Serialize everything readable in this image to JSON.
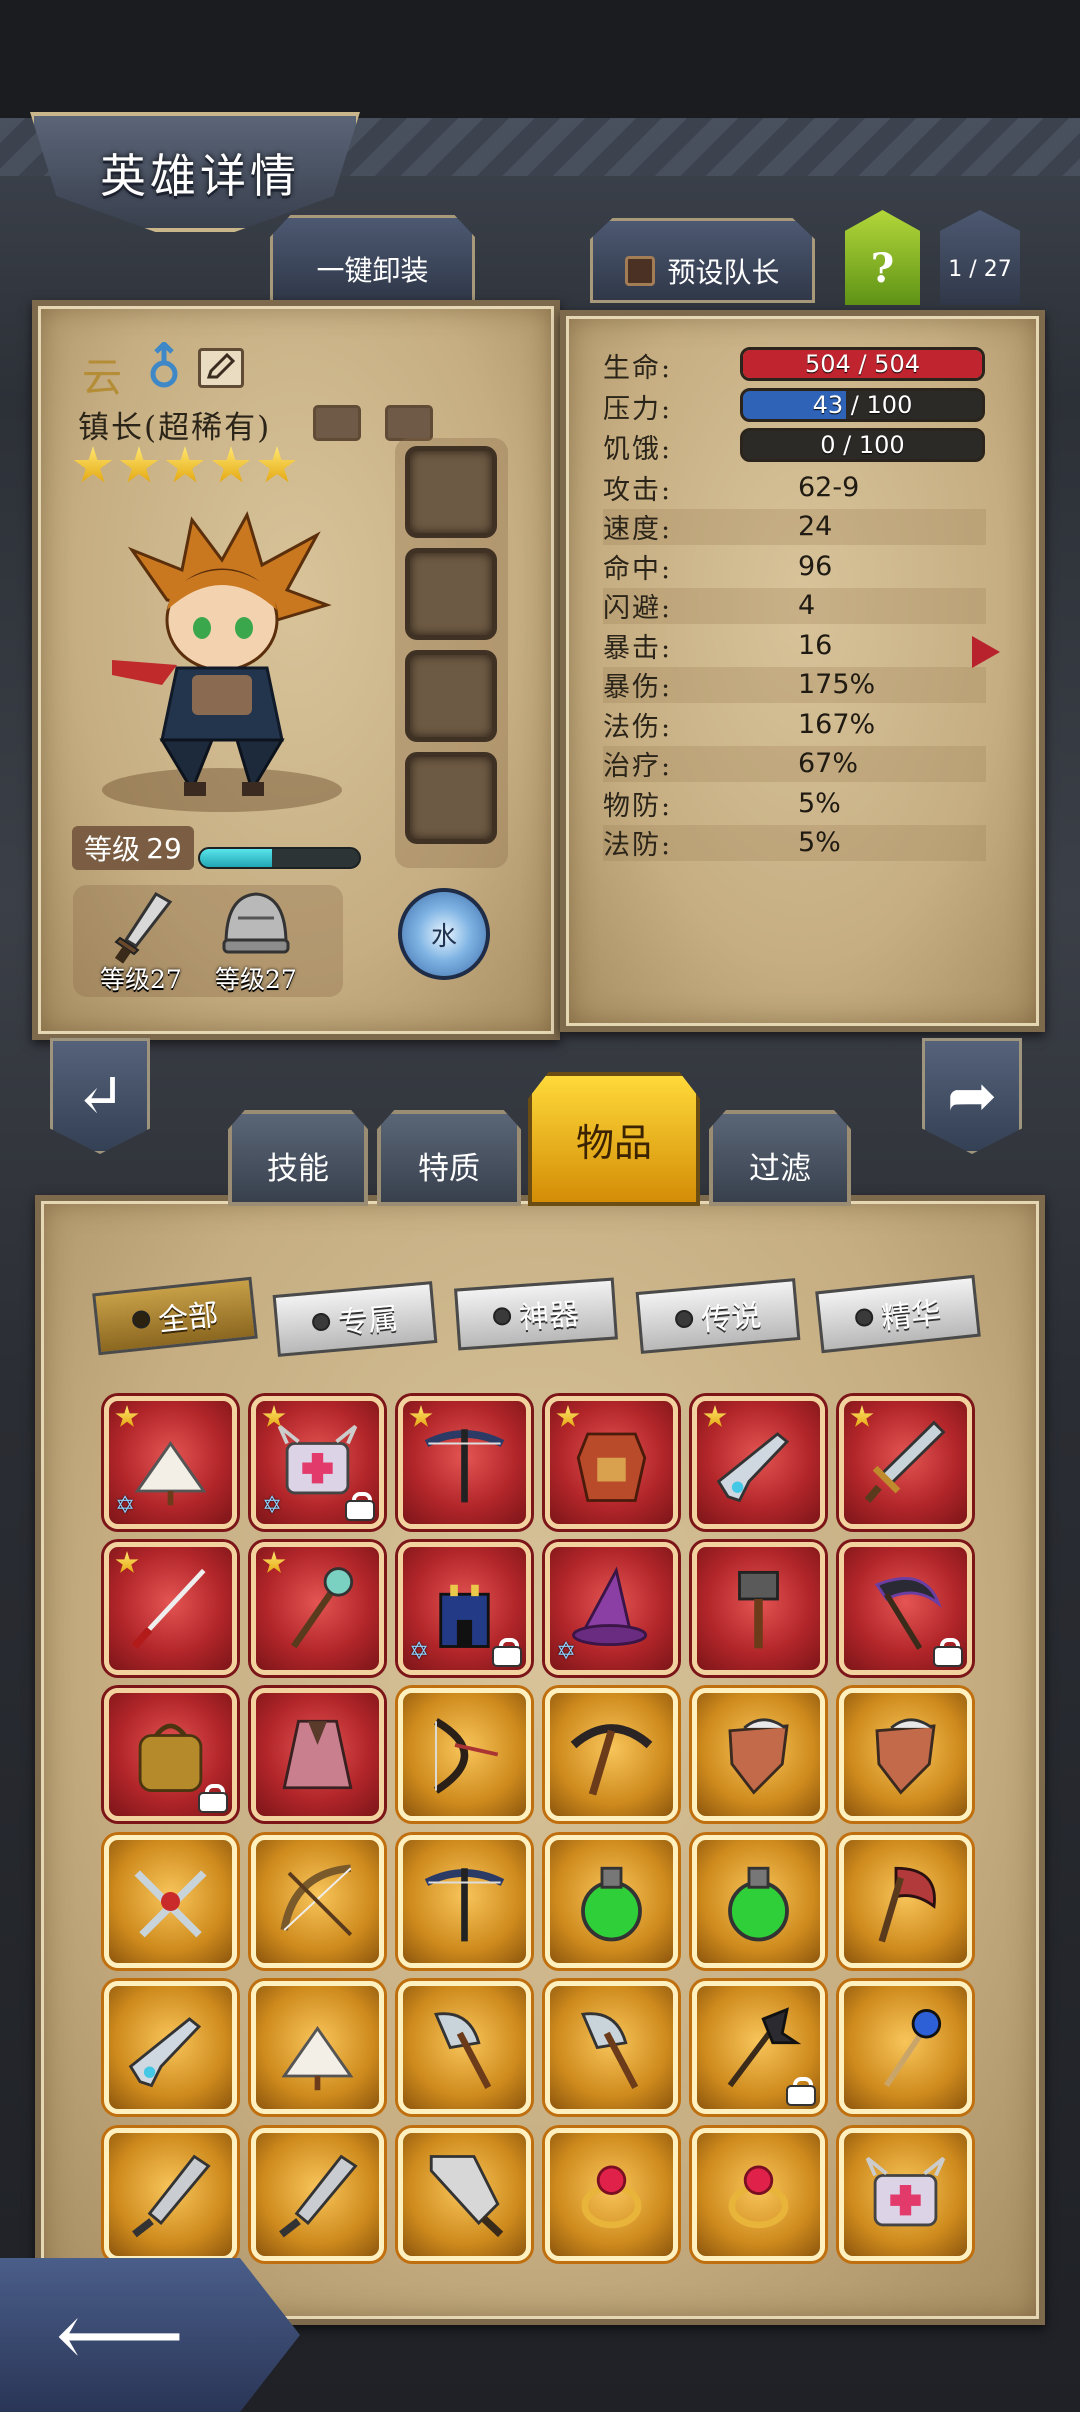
{
  "header": {
    "title": "英雄详情"
  },
  "top_buttons": {
    "unequip_all": "一键卸装",
    "preset_leader": "预设队长",
    "help": "?",
    "page_counter": "1 / 27"
  },
  "hero": {
    "element_char": "云",
    "gender_icon": "male-symbol-icon",
    "name": "镇长(超稀有)",
    "stars": 5,
    "level_label": "等级",
    "level": "29",
    "xp_fraction": 0.45,
    "gear": [
      {
        "icon": "sword-icon",
        "label": "等级27"
      },
      {
        "icon": "helmet-icon",
        "label": "等级27"
      }
    ],
    "element_badge": "水"
  },
  "stats": {
    "bars": [
      {
        "label": "生命:",
        "value": "504 / 504",
        "fraction": 1.0,
        "color": "#c0242f"
      },
      {
        "label": "压力:",
        "value": "43 / 100",
        "fraction": 0.43,
        "color": "#2e63b8"
      },
      {
        "label": "饥饿:",
        "value": "0 / 100",
        "fraction": 0.0,
        "color": "#555555"
      }
    ],
    "rows": [
      {
        "label": "攻击:",
        "value": "62-9"
      },
      {
        "label": "速度:",
        "value": "24"
      },
      {
        "label": "命中:",
        "value": "96"
      },
      {
        "label": "闪避:",
        "value": "4"
      },
      {
        "label": "暴击:",
        "value": "16"
      },
      {
        "label": "暴伤:",
        "value": "175%"
      },
      {
        "label": "法伤:",
        "value": "167%"
      },
      {
        "label": "治疗:",
        "value": "67%"
      },
      {
        "label": "物防:",
        "value": "5%"
      },
      {
        "label": "法防:",
        "value": "5%"
      }
    ]
  },
  "tabs": {
    "skills": "技能",
    "traits": "特质",
    "items": "物品",
    "filter": "过滤"
  },
  "filters": [
    {
      "label": "全部",
      "active": true
    },
    {
      "label": "专属",
      "active": false
    },
    {
      "label": "神器",
      "active": false
    },
    {
      "label": "传说",
      "active": false
    },
    {
      "label": "精华",
      "active": false
    }
  ],
  "inventory": [
    {
      "name": "feather-fan-icon",
      "rarity": "red",
      "star": true,
      "locked": false,
      "hex": true
    },
    {
      "name": "spiked-medkit-icon",
      "rarity": "red",
      "star": true,
      "locked": true,
      "hex": true
    },
    {
      "name": "crossbow-icon",
      "rarity": "red",
      "star": true,
      "locked": false,
      "hex": false
    },
    {
      "name": "armor-icon",
      "rarity": "red",
      "star": true,
      "locked": false,
      "hex": false
    },
    {
      "name": "rifle-icon",
      "rarity": "red",
      "star": true,
      "locked": false,
      "hex": false
    },
    {
      "name": "sword-icon",
      "rarity": "red",
      "star": true,
      "locked": false,
      "hex": false
    },
    {
      "name": "katana-icon",
      "rarity": "red",
      "star": true,
      "locked": false,
      "hex": false
    },
    {
      "name": "staff-icon",
      "rarity": "red",
      "star": true,
      "locked": false,
      "hex": false
    },
    {
      "name": "castle-icon",
      "rarity": "red",
      "star": false,
      "locked": true,
      "hex": true
    },
    {
      "name": "wizard-hat-icon",
      "rarity": "red",
      "star": false,
      "locked": false,
      "hex": true
    },
    {
      "name": "hammer-icon",
      "rarity": "red",
      "star": false,
      "locked": false,
      "hex": false
    },
    {
      "name": "scythe-icon",
      "rarity": "red",
      "star": false,
      "locked": true,
      "hex": false
    },
    {
      "name": "backpack-icon",
      "rarity": "red",
      "star": false,
      "locked": true,
      "hex": false
    },
    {
      "name": "cloak-icon",
      "rarity": "red",
      "star": false,
      "locked": false,
      "hex": false
    },
    {
      "name": "bow-dark-icon",
      "rarity": "gold",
      "star": false,
      "locked": false,
      "hex": false
    },
    {
      "name": "pickaxe-icon",
      "rarity": "gold",
      "star": false,
      "locked": false,
      "hex": false
    },
    {
      "name": "shield-icon",
      "rarity": "gold",
      "star": false,
      "locked": false,
      "hex": false
    },
    {
      "name": "shield-icon",
      "rarity": "gold",
      "star": false,
      "locked": false,
      "hex": false
    },
    {
      "name": "crossed-blades-icon",
      "rarity": "gold",
      "star": false,
      "locked": false,
      "hex": false
    },
    {
      "name": "bow-icon",
      "rarity": "gold",
      "star": false,
      "locked": false,
      "hex": false
    },
    {
      "name": "crossbow-icon",
      "rarity": "gold",
      "star": false,
      "locked": false,
      "hex": false
    },
    {
      "name": "potion-icon",
      "rarity": "gold",
      "star": false,
      "locked": false,
      "hex": false
    },
    {
      "name": "potion-icon",
      "rarity": "gold",
      "star": false,
      "locked": false,
      "hex": false
    },
    {
      "name": "battle-axe-icon",
      "rarity": "gold",
      "star": false,
      "locked": false,
      "hex": false
    },
    {
      "name": "rifle-icon",
      "rarity": "gold",
      "star": false,
      "locked": false,
      "hex": false
    },
    {
      "name": "feather-fan-icon",
      "rarity": "gold",
      "star": false,
      "locked": false,
      "hex": false
    },
    {
      "name": "axe-icon",
      "rarity": "gold",
      "star": false,
      "locked": false,
      "hex": false
    },
    {
      "name": "axe-icon",
      "rarity": "gold",
      "star": false,
      "locked": false,
      "hex": false
    },
    {
      "name": "dark-staff-icon",
      "rarity": "gold",
      "star": false,
      "locked": true,
      "hex": false
    },
    {
      "name": "orb-staff-icon",
      "rarity": "gold",
      "star": false,
      "locked": false,
      "hex": false
    },
    {
      "name": "broadsword-icon",
      "rarity": "gold",
      "star": false,
      "locked": false,
      "hex": false
    },
    {
      "name": "broadsword-icon",
      "rarity": "gold",
      "star": false,
      "locked": false,
      "hex": false
    },
    {
      "name": "cleaver-icon",
      "rarity": "gold",
      "star": false,
      "locked": false,
      "hex": false
    },
    {
      "name": "ruby-ring-icon",
      "rarity": "gold",
      "star": false,
      "locked": false,
      "hex": false
    },
    {
      "name": "ruby-ring-icon",
      "rarity": "gold",
      "star": false,
      "locked": false,
      "hex": false
    },
    {
      "name": "spiked-medkit-icon",
      "rarity": "gold",
      "star": false,
      "locked": false,
      "hex": false
    }
  ]
}
